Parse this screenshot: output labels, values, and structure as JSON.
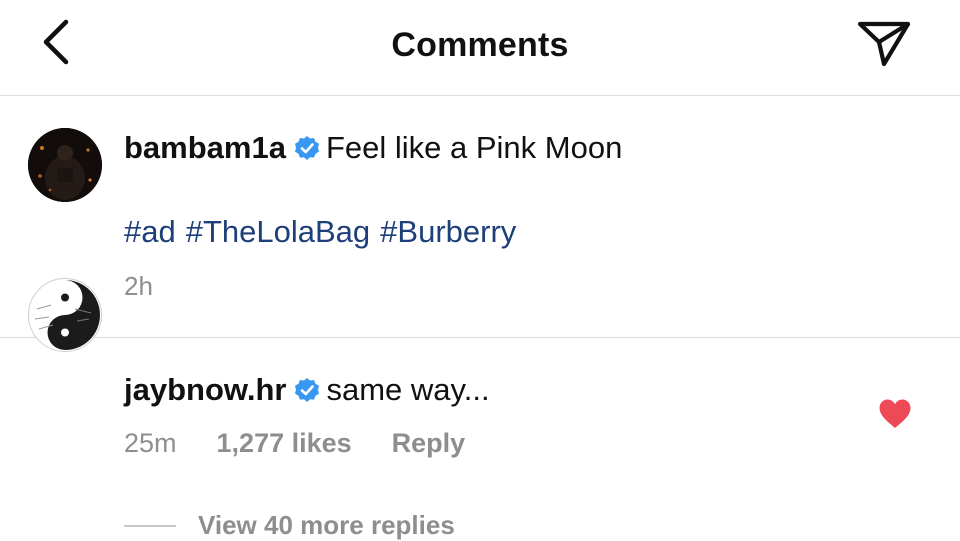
{
  "header": {
    "back_icon": "chevron-left-icon",
    "title": "Comments",
    "share_icon": "paper-plane-icon"
  },
  "caption": {
    "username": "bambam1a",
    "verified": true,
    "text": "Feel like a Pink Moon",
    "hashtags": [
      "#ad",
      "#TheLolaBag",
      "#Burberry"
    ],
    "time": "2h"
  },
  "comment": {
    "username": "jaybnow.hr",
    "verified": true,
    "text": "same way...",
    "time": "25m",
    "likes": "1,277 likes",
    "reply_label": "Reply",
    "liked": true,
    "view_replies_label": "View 40 more replies"
  },
  "colors": {
    "hashtag": "#1d3f7a",
    "verified_badge": "#3897f0",
    "heart": "#ed4956",
    "meta_gray": "#8e8e8e"
  }
}
